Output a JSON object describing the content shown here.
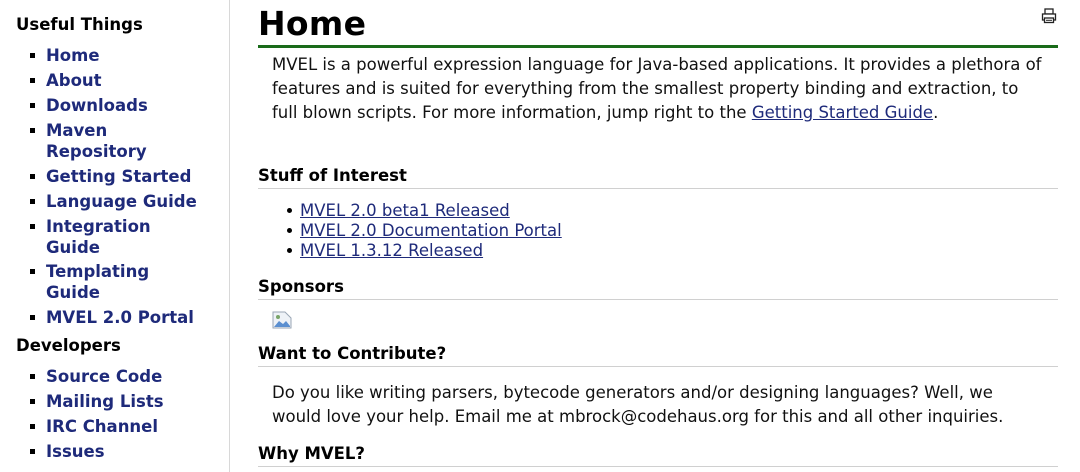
{
  "sidebar": {
    "useful_heading": "Useful Things",
    "useful_items": [
      {
        "label": "Home"
      },
      {
        "label": "About"
      },
      {
        "label": "Downloads"
      },
      {
        "label": "Maven Repository"
      },
      {
        "label": "Getting Started"
      },
      {
        "label": "Language Guide"
      },
      {
        "label": "Integration Guide"
      },
      {
        "label": "Templating Guide"
      },
      {
        "label": "MVEL 2.0 Portal"
      }
    ],
    "dev_heading": "Developers",
    "dev_items": [
      {
        "label": "Source Code"
      },
      {
        "label": "Mailing Lists"
      },
      {
        "label": "IRC Channel"
      },
      {
        "label": "Issues"
      }
    ]
  },
  "main": {
    "title": "Home",
    "print_icon": "printer-icon",
    "intro_text": "MVEL is a powerful expression language for Java-based applications. It provides a plethora of features and is suited for everything from the smallest property binding and extraction, to full blown scripts. For more information, jump right to the",
    "intro_link": "Getting Started Guide",
    "intro_end": ".",
    "stuff_heading": "Stuff of Interest",
    "news": [
      {
        "label": "MVEL 2.0 beta1 Released"
      },
      {
        "label": "MVEL 2.0 Documentation Portal"
      },
      {
        "label": "MVEL 1.3.12 Released"
      }
    ],
    "sponsors_heading": "Sponsors",
    "sponsor_image": "broken-image-icon",
    "contribute_heading": "Want to Contribute?",
    "contribute_text": "Do you like writing parsers, bytecode generators and/or designing languages? Well, we would love your help. Email me at mbrock@codehaus.org for this and all other inquiries.",
    "why_heading": "Why MVEL?"
  }
}
